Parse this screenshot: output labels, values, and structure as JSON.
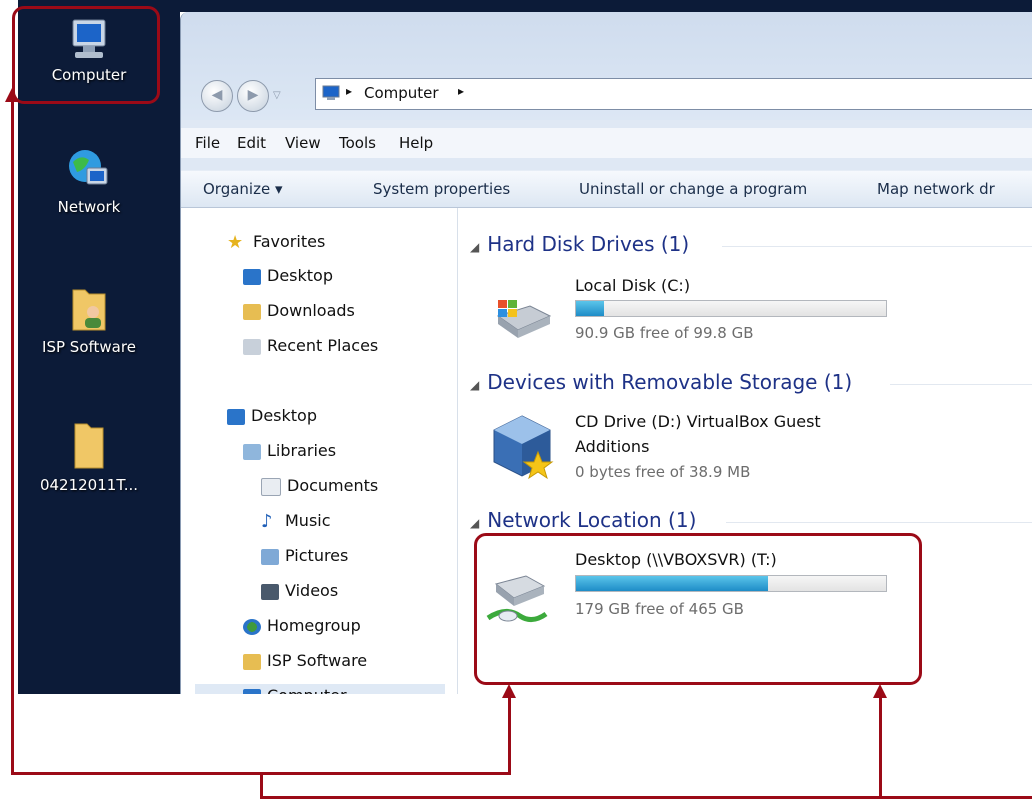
{
  "desktop": {
    "icons": [
      {
        "label": "Computer",
        "icon": "computer-icon"
      },
      {
        "label": "Network",
        "icon": "network-icon"
      },
      {
        "label": "ISP Software",
        "icon": "user-folder-icon"
      },
      {
        "label": "04212011T...",
        "icon": "folder-icon"
      }
    ]
  },
  "address_bar": {
    "path": "Computer",
    "separator": "▸"
  },
  "menu": {
    "items": [
      "File",
      "Edit",
      "View",
      "Tools",
      "Help"
    ]
  },
  "commands": {
    "organize": "Organize ▾",
    "system_properties": "System properties",
    "uninstall": "Uninstall or change a program",
    "map_network": "Map network dr"
  },
  "nav_pane": {
    "favorites": "Favorites",
    "fav_items": [
      "Desktop",
      "Downloads",
      "Recent Places"
    ],
    "desktop": "Desktop",
    "libraries": "Libraries",
    "lib_items": [
      "Documents",
      "Music",
      "Pictures",
      "Videos"
    ],
    "homegroup": "Homegroup",
    "isp_software": "ISP Software",
    "computer": "Computer"
  },
  "content": {
    "groups": [
      {
        "title": "Hard Disk Drives (1)"
      },
      {
        "title": "Devices with Removable Storage (1)"
      },
      {
        "title": "Network Location (1)"
      }
    ],
    "drives": [
      {
        "name": "Local Disk (C:)",
        "free": "90.9 GB free of 99.8 GB",
        "used_fraction": 0.09,
        "icon": "windows-drive-icon"
      },
      {
        "name_line1": "CD Drive (D:) VirtualBox Guest",
        "name_line2": "Additions",
        "free": "0 bytes free of 38.9 MB",
        "icon": "virtualbox-cd-icon"
      },
      {
        "name": "Desktop (\\\\VBOXSVR) (T:)",
        "free": "179 GB free of 465 GB",
        "used_fraction": 0.62,
        "icon": "network-drive-icon"
      }
    ]
  },
  "colors": {
    "annotation": "#9b0a17",
    "group_text": "#1e3287"
  }
}
